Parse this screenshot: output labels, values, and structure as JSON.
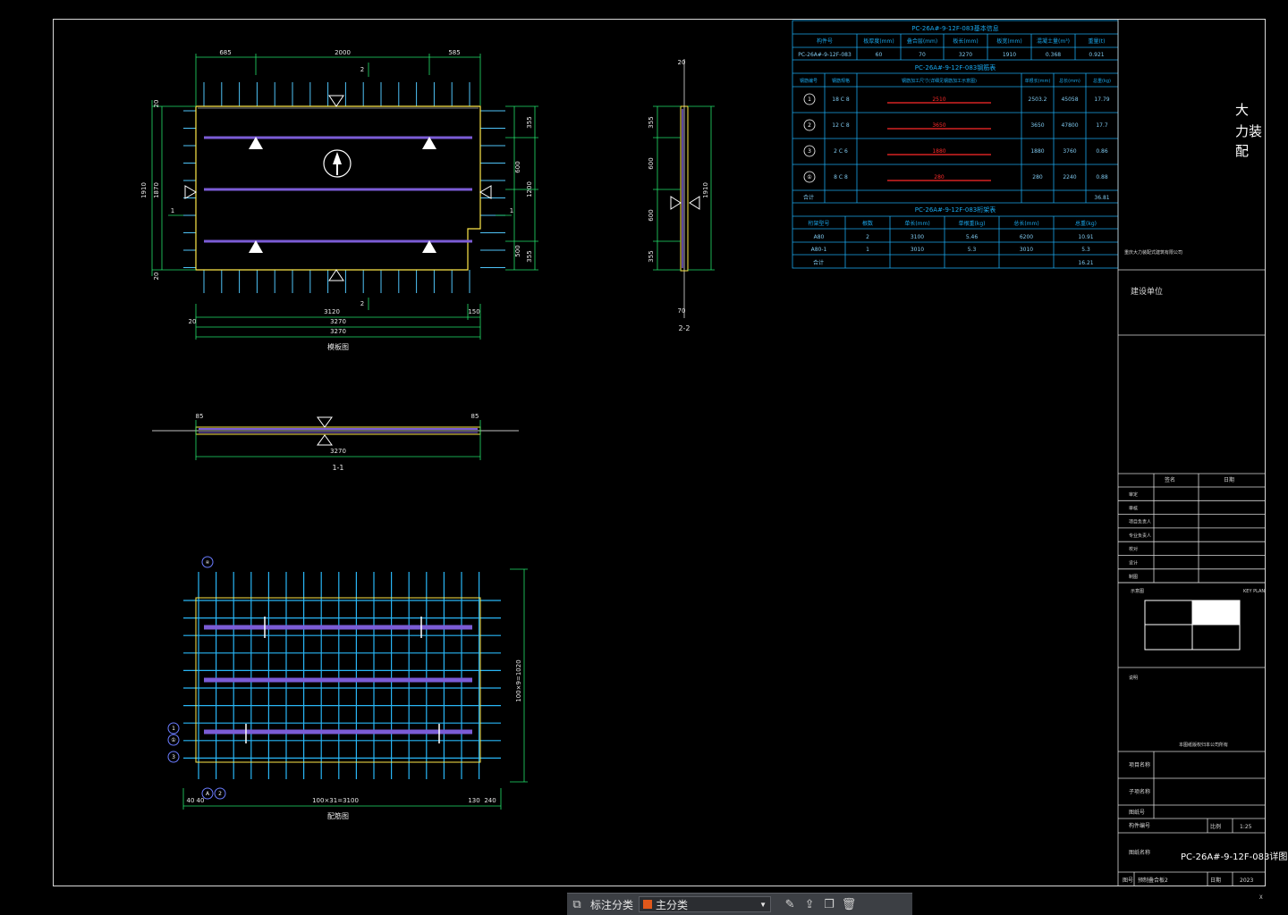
{
  "plan_view": {
    "title": "模板图",
    "top_dims": [
      "685",
      "2000",
      "585"
    ],
    "bottom_dims": [
      "3120",
      "150"
    ],
    "bottom_extra": [
      "20",
      "3270",
      "3270"
    ],
    "left_dims": [
      "1910",
      "1870",
      "20",
      "20"
    ],
    "right_dims": [
      "355",
      "600",
      "1200",
      "500",
      "355"
    ],
    "section_marks": [
      "1",
      "1",
      "2",
      "2"
    ]
  },
  "section_1": {
    "title": "1-1",
    "dim": "3270",
    "end_dims": [
      "85",
      "85"
    ]
  },
  "section_2": {
    "title": "2-2",
    "dims": [
      "355",
      "600",
      "600",
      "355",
      "1910"
    ],
    "top": "20",
    "bot": "70"
  },
  "rebar_view": {
    "title": "配筋图",
    "bottom_dim": "100×31=3100",
    "side_dim": "100×9=1020",
    "left_marks": [
      "1",
      "①",
      "3"
    ],
    "top_mark": "④",
    "bottom_marks": [
      "A",
      "2"
    ],
    "small_dims": [
      "40",
      "40",
      "130",
      "240"
    ]
  },
  "table_info": {
    "title": "PC-26A#-9-12F-083基本信息",
    "headers": [
      "构件号",
      "板厚度(mm)",
      "叠合层(mm)",
      "板长(mm)",
      "板宽(mm)",
      "混凝土量(m³)",
      "重量(t)"
    ],
    "row": [
      "PC-26A#-9-12F-083",
      "60",
      "70",
      "3270",
      "1910",
      "0.368",
      "0.921"
    ]
  },
  "table_rebar": {
    "title": "PC-26A#-9-12F-083钢筋表",
    "headers": [
      "钢筋编号",
      "钢筋规格",
      "钢筋加工尺寸(详细见钢筋加工示意图)",
      "单根长(mm)",
      "总长(mm)",
      "总重(kg)"
    ],
    "rows": [
      {
        "no": "1",
        "spec": "18 C 8",
        "shape": "2510",
        "len": "2503.2",
        "total": "45058",
        "kg": "17.79"
      },
      {
        "no": "2",
        "spec": "12 C 8",
        "shape": "3650",
        "len": "3650",
        "total": "47800",
        "kg": "17.7"
      },
      {
        "no": "3",
        "spec": "2 C 6",
        "shape": "1880",
        "len": "1880",
        "total": "3760",
        "kg": "0.86"
      },
      {
        "no": "①",
        "spec": "8 C 8",
        "shape": "280",
        "len": "280",
        "total": "2240",
        "kg": "0.88"
      }
    ],
    "sum_label": "合计",
    "sum_value": "36.81"
  },
  "table_truss": {
    "title": "PC-26A#-9-12F-083桁架表",
    "headers": [
      "桁架型号",
      "根数",
      "单长(mm)",
      "单根重(kg)",
      "总长(mm)",
      "总重(kg)"
    ],
    "rows": [
      [
        "A80",
        "2",
        "3100",
        "5.46",
        "6200",
        "10.91"
      ],
      [
        "A80-1",
        "1",
        "3010",
        "5.3",
        "3010",
        "5.3"
      ]
    ],
    "sum_label": "合计",
    "sum_value": "16.21"
  },
  "title_block": {
    "company": [
      "大",
      "力装",
      "配"
    ],
    "company_small": "重庆大力装配式建筑有限公司",
    "client_label": "建设单位",
    "sign_headers": [
      "签名",
      "日期"
    ],
    "roles": [
      "审定",
      "审核",
      "项目负责人",
      "专业负责人",
      "校对",
      "设计",
      "制图"
    ],
    "key_plan_label": "示意图",
    "key_plan_right": "KEY PLAN",
    "notes_label": "说明",
    "notes_small": "本图纸版权归本公司所有",
    "project_label": "项目名称",
    "sub_label": "子项名称",
    "drawing_no_label": "图纸号",
    "scale_row_label": "构件编号",
    "scale_label": "比例",
    "scale_value": "1:25",
    "drawing_name_label": "图纸名称",
    "drawing_name": "PC-26A#-9-12F-083详图",
    "date_label": "日期",
    "date_value": "2023",
    "sheet_label": "图号",
    "sheet_value": "预制叠合板2"
  },
  "toolbar": {
    "label1": "标注分类",
    "layer_name": "主分类",
    "dropdown_icon": "chevron-down-icon"
  },
  "corner_text": "X"
}
